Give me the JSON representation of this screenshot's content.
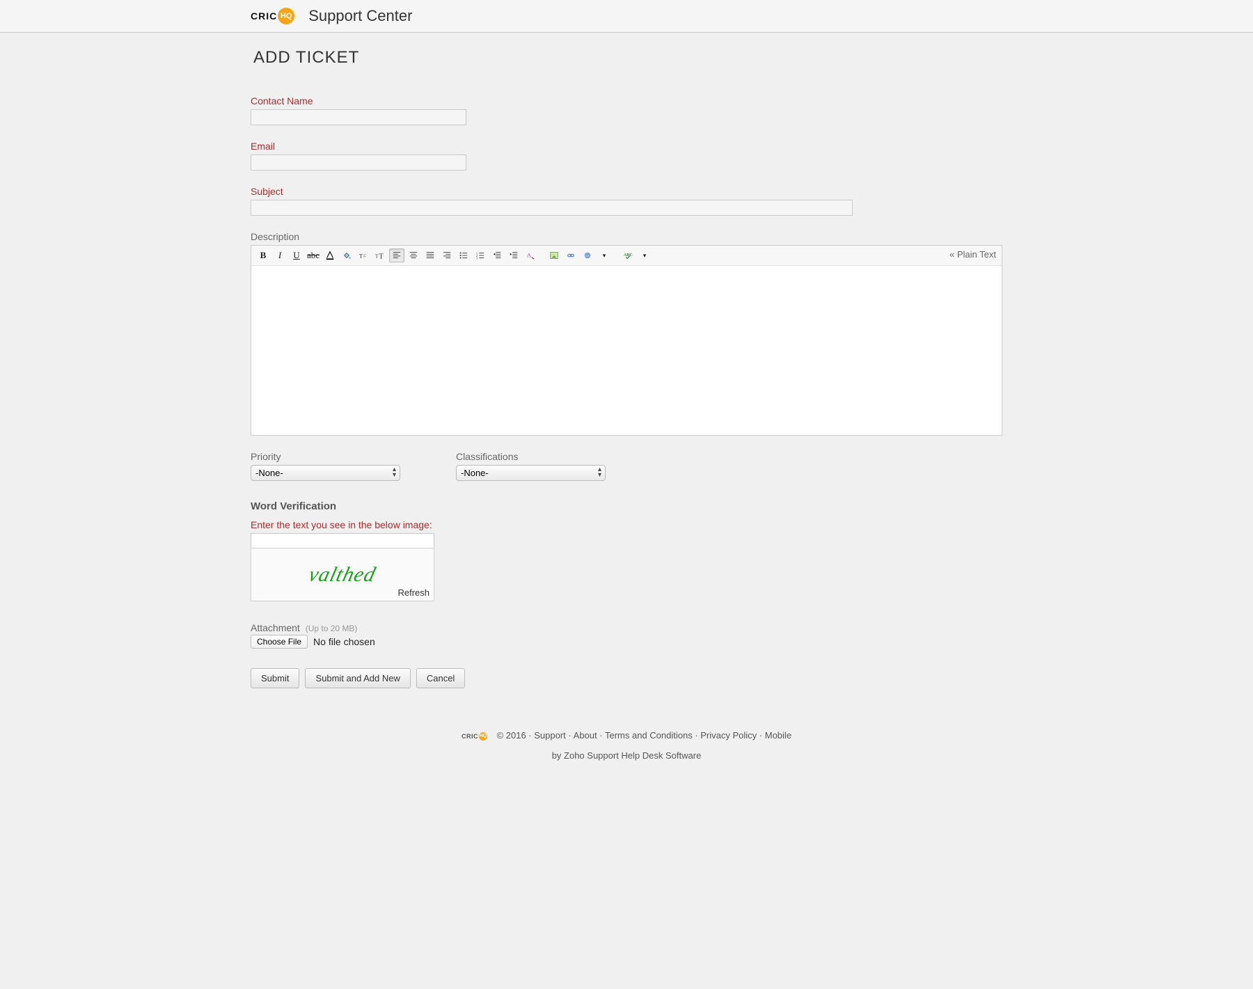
{
  "header": {
    "logo_text_part1": "CRIC",
    "logo_text_part2": "HQ",
    "site_title": "Support Center"
  },
  "page": {
    "title": "ADD TICKET"
  },
  "fields": {
    "contact_name": {
      "label": "Contact Name",
      "value": ""
    },
    "email": {
      "label": "Email",
      "value": ""
    },
    "subject": {
      "label": "Subject",
      "value": ""
    },
    "description": {
      "label": "Description",
      "value": ""
    },
    "priority": {
      "label": "Priority",
      "selected": "-None-"
    },
    "classifications": {
      "label": "Classifications",
      "selected": "-None-"
    }
  },
  "editor": {
    "plain_text_toggle": "« Plain Text"
  },
  "word_verification": {
    "heading": "Word Verification",
    "instruction": "Enter the text you see in the below image:",
    "captcha_text": "valthed",
    "refresh": "Refresh",
    "value": ""
  },
  "attachment": {
    "label": "Attachment",
    "note": "(Up to 20 MB)",
    "button": "Choose File",
    "status": "No file chosen"
  },
  "buttons": {
    "submit": "Submit",
    "submit_add_new": "Submit and Add New",
    "cancel": "Cancel"
  },
  "footer": {
    "copyright": "© 2016 ·",
    "links": {
      "support": "Support",
      "about": "About",
      "terms": "Terms and Conditions",
      "privacy": "Privacy Policy",
      "mobile": "Mobile"
    },
    "by_line_prefix": "by Zoho Support ",
    "by_line_link": "Help Desk Software"
  }
}
